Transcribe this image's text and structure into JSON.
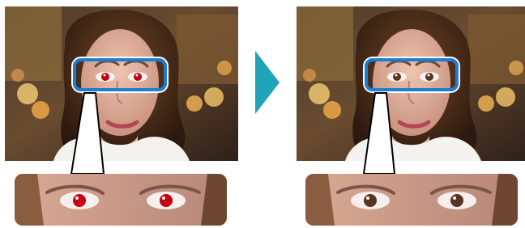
{
  "colors": {
    "highlight": "#1c7ed2",
    "arrow": "#1fa4ba",
    "redeye": "#c40012",
    "fixedEye": "#5a3422"
  },
  "icons": {
    "arrow": "right-arrow-icon"
  },
  "states": {
    "before": {
      "name": "before-correction"
    },
    "after": {
      "name": "after-correction"
    }
  }
}
